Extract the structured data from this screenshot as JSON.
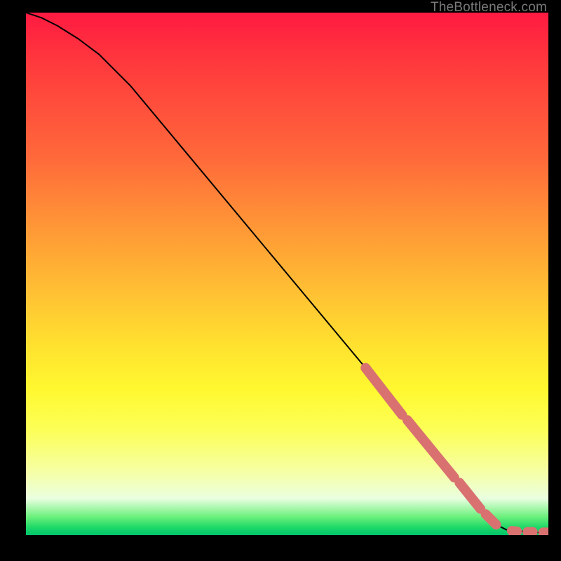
{
  "attribution": "TheBottleneck.com",
  "chart_data": {
    "type": "line",
    "title": "",
    "xlabel": "",
    "ylabel": "",
    "xlim": [
      0,
      100
    ],
    "ylim": [
      0,
      100
    ],
    "grid": false,
    "series": [
      {
        "name": "curve",
        "x": [
          0,
          3,
          6,
          10,
          14,
          20,
          30,
          40,
          50,
          60,
          65,
          70,
          75,
          80,
          84,
          88,
          90,
          92,
          94,
          96,
          98,
          100
        ],
        "y": [
          100,
          99,
          97.5,
          95,
          92,
          86,
          74,
          62,
          50,
          38,
          32,
          26,
          20,
          14,
          9,
          4,
          2,
          1,
          0.8,
          0.6,
          0.5,
          0.5
        ]
      }
    ],
    "markers": {
      "name": "highlighted-points",
      "color": "#d97171",
      "clusters": [
        {
          "x_start": 65,
          "x_end": 72,
          "y_start": 32,
          "y_end": 23
        },
        {
          "x_start": 73,
          "x_end": 82,
          "y_start": 22,
          "y_end": 11
        },
        {
          "x_start": 83,
          "x_end": 87,
          "y_start": 10,
          "y_end": 5
        },
        {
          "x_start": 88,
          "x_end": 90,
          "y_start": 4,
          "y_end": 2
        },
        {
          "x_start": 93,
          "x_end": 94,
          "y_start": 0.8,
          "y_end": 0.7
        },
        {
          "x_start": 96,
          "x_end": 97,
          "y_start": 0.6,
          "y_end": 0.6
        },
        {
          "x_start": 99,
          "x_end": 100,
          "y_start": 0.5,
          "y_end": 0.5
        }
      ]
    }
  }
}
